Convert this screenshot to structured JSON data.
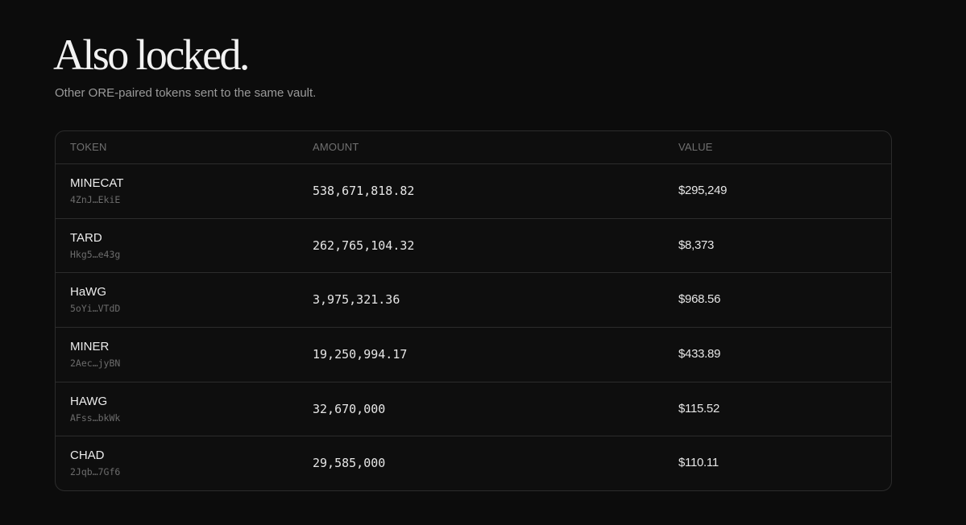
{
  "section": {
    "title": "Also locked.",
    "subtitle": "Other ORE-paired tokens sent to the same vault."
  },
  "table": {
    "headers": [
      "TOKEN",
      "AMOUNT",
      "VALUE"
    ],
    "rows": [
      {
        "symbol": "MINECAT",
        "address": "4ZnJ…EkiE",
        "amount": "538,671,818.82",
        "value": "$295,249"
      },
      {
        "symbol": "TARD",
        "address": "Hkg5…e43g",
        "amount": "262,765,104.32",
        "value": "$8,373"
      },
      {
        "symbol": "HaWG",
        "address": "5oYi…VTdD",
        "amount": "3,975,321.36",
        "value": "$968.56"
      },
      {
        "symbol": "MINER",
        "address": "2Aec…jyBN",
        "amount": "19,250,994.17",
        "value": "$433.89"
      },
      {
        "symbol": "HAWG",
        "address": "AFss…bkWk",
        "amount": "32,670,000",
        "value": "$115.52"
      },
      {
        "symbol": "CHAD",
        "address": "2Jqb…7Gf6",
        "amount": "29,585,000",
        "value": "$110.11"
      }
    ]
  },
  "colors": {
    "background": "#0c0c0c",
    "border": "#2c2c2c",
    "text_primary": "#ececec",
    "text_muted": "#9a9a9a",
    "text_dim": "#6c6c6c"
  }
}
